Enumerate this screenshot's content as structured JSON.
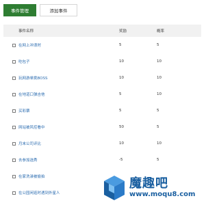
{
  "tabs": {
    "manage": "事件管理",
    "add": "添加事件"
  },
  "table": {
    "headers": {
      "name": "事件名称",
      "reward": "奖励",
      "prob": "概率"
    },
    "rows": [
      {
        "name": "在网上冲浪时",
        "reward": "5",
        "prob": "5"
      },
      {
        "name": "吃包子",
        "reward": "10",
        "prob": "10"
      },
      {
        "name": "玩网游单挑BOSS",
        "reward": "10",
        "prob": "10"
      },
      {
        "name": "在地道口弹吉他",
        "reward": "5",
        "prob": "10"
      },
      {
        "name": "买彩票",
        "reward": "5",
        "prob": "5"
      },
      {
        "name": "网站被风控看中",
        "reward": "50",
        "prob": "5"
      },
      {
        "name": "月末公司评比",
        "reward": "10",
        "prob": "10"
      },
      {
        "name": "去参加选秀",
        "reward": "-5",
        "prob": "5"
      },
      {
        "name": "在家洗澡被偷拍",
        "reward": "",
        "prob": ""
      },
      {
        "name": "在公园闲逛时遇到外星人",
        "reward": "",
        "prob": ""
      }
    ]
  },
  "watermark": {
    "cn": "魔趣吧",
    "url": "www.moqu8.com"
  },
  "colors": {
    "primary": "#2e7d32",
    "link": "#2b6cb0",
    "header_bg": "#f1f1f1",
    "watermark": "#1a5fa0"
  }
}
